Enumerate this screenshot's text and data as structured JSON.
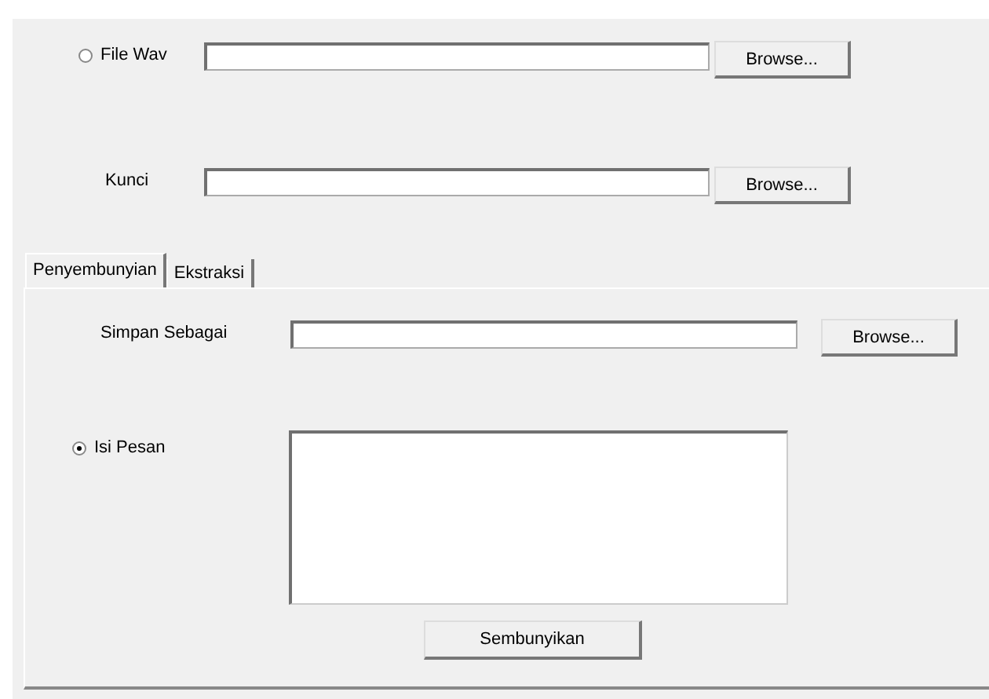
{
  "file_wav": {
    "label": "File Wav",
    "selected": false,
    "button": "Browse..."
  },
  "kunci": {
    "label": "Kunci",
    "button": "Browse..."
  },
  "tabs": [
    {
      "label": "Penyembunyian",
      "selected": true
    },
    {
      "label": "Ekstraksi",
      "selected": false
    }
  ],
  "simpan": {
    "label": "Simpan Sebagai",
    "button": "Browse..."
  },
  "isi_pesan": {
    "label": "Isi Pesan",
    "selected": true
  },
  "action_button": "Sembunyikan"
}
